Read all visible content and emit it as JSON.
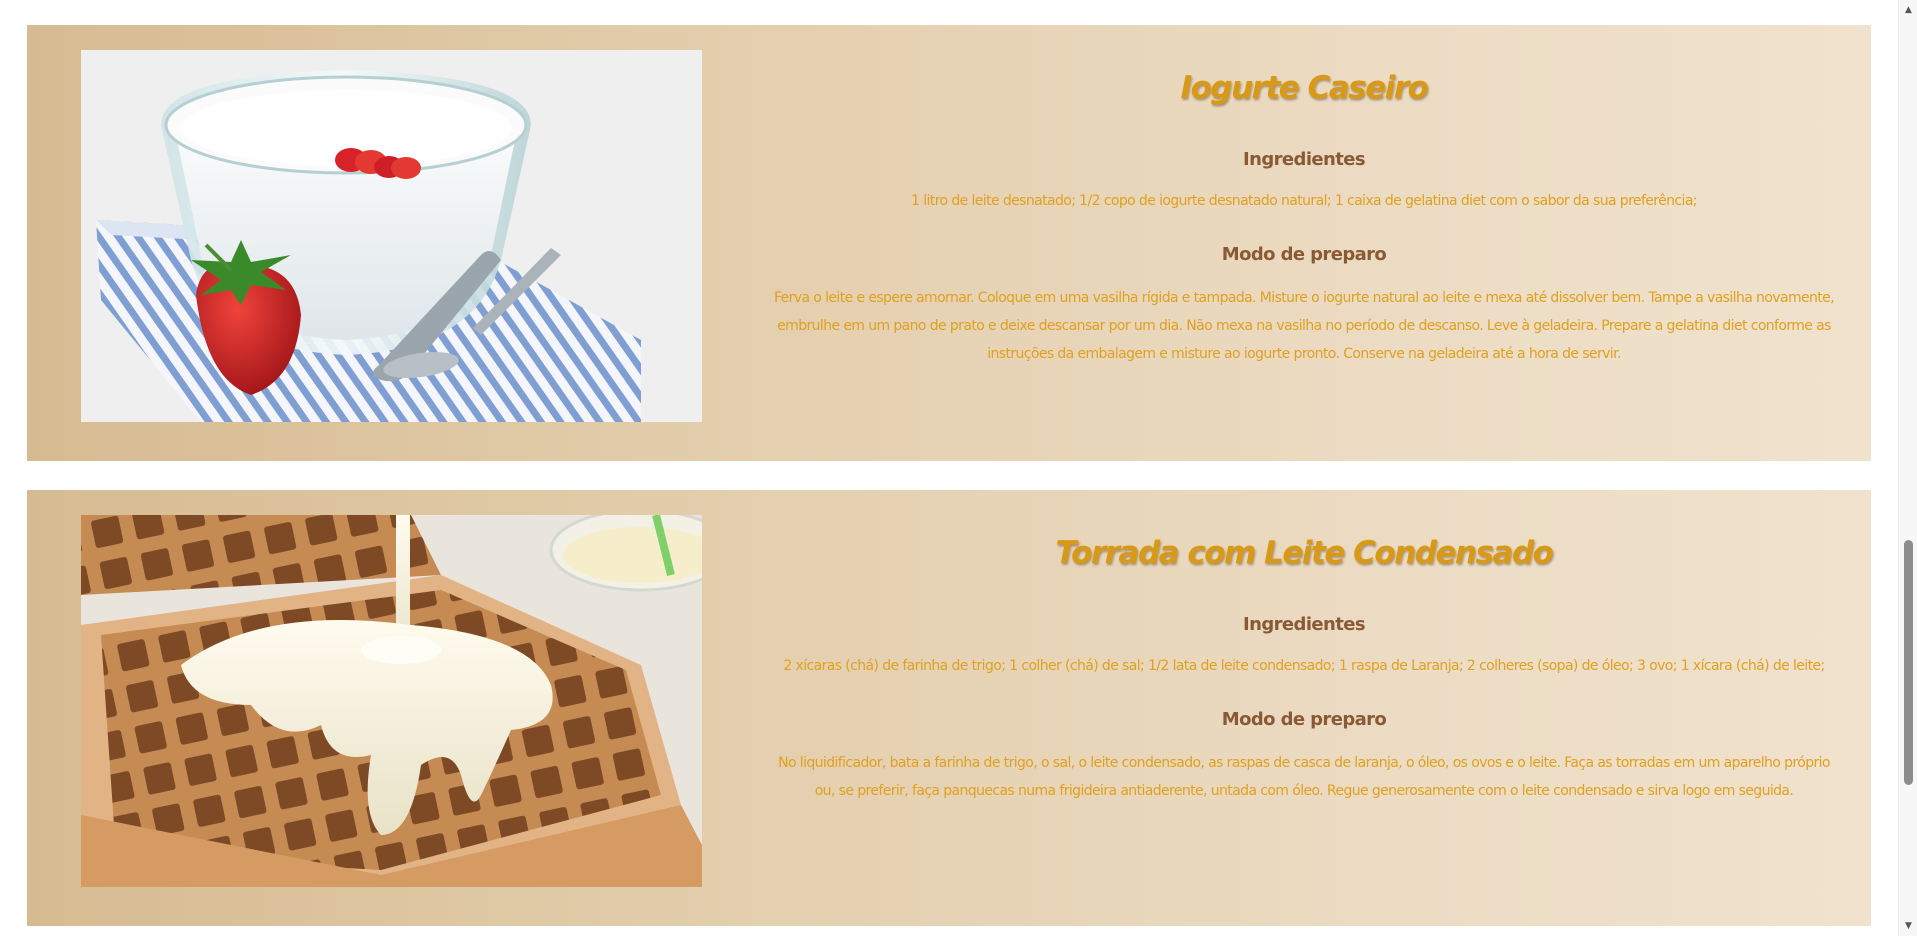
{
  "recipes": [
    {
      "title": "Iogurte Caseiro",
      "ingredients_heading": "Ingredientes",
      "ingredients": "1 litro de leite desnatado; 1/2 copo de iogurte desnatado natural; 1 caixa de gelatina diet com o sabor da sua preferência;",
      "prep_heading": "Modo de preparo",
      "prep": "Ferva o leite e espere amornar. Coloque em uma vasilha rígida e tampada. Misture o iogurte natural ao leite e mexa até dissolver bem. Tampe a vasilha novamente, embrulhe em um pano de prato e deixe descansar por um dia. Não mexa na vasilha no período de descanso. Leve à geladeira. Prepare a gelatina diet conforme as instruções da embalagem e misture ao iogurte pronto. Conserve na geladeira até a hora de servir."
    },
    {
      "title": "Torrada com Leite Condensado",
      "ingredients_heading": "Ingredientes",
      "ingredients": "2 xícaras (chá) de farinha de trigo; 1 colher (chá) de sal; 1/2 lata de leite condensado; 1 raspa de Laranja; 2 colheres (sopa) de óleo; 3 ovo; 1 xícara (chá) de leite;",
      "prep_heading": "Modo de preparo",
      "prep": "No liquidificador, bata a farinha de trigo, o sal, o leite condensado, as raspas de casca de laranja, o óleo, os ovos e o leite. Faça as torradas em um aparelho próprio ou, se preferir, faça panquecas numa frigideira antiaderente, untada com óleo. Regue generosamente com o leite condensado e sirva logo em seguida."
    }
  ],
  "colors": {
    "title": "#d89a16",
    "heading": "#8a5a36",
    "body": "#e0a020",
    "card_left": "#d6bb92",
    "card_right": "#f0e2cd"
  },
  "scrollbar": {
    "up_icon": "triangle-up",
    "down_icon": "triangle-down"
  }
}
